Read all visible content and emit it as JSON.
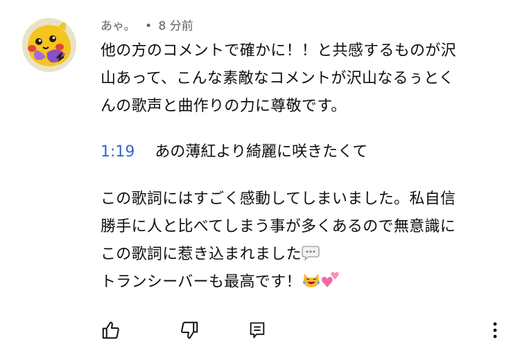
{
  "comment": {
    "author": "あゃ。",
    "separator": "•",
    "time": "8 分前",
    "avatar_icon": "pikachu-avatar",
    "paragraph1": [
      "他の方のコメントで確かに！！と共感するものが沢",
      "山あって、こんな素敵なコメントが沢山なるぅとく",
      "んの歌声と曲作りの力に尊敬です。"
    ],
    "timestamp_link": "1:19",
    "timestamp_text": "あの薄紅より綺麗に咲きたくて",
    "paragraph2": [
      "この歌詞にはすごく感動してしまいました。私自信",
      "勝手に人と比べてしまう事が多くあるので無意識に",
      "この歌詞に惹き込まれました",
      "トランシーバーも最高です！"
    ],
    "emojis": [
      "speech-bubble-icon",
      "laughing-cat-icon",
      "two-hearts-icon"
    ]
  },
  "actions": {
    "like_icon": "thumbs-up-icon",
    "dislike_icon": "thumbs-down-icon",
    "reply_icon": "reply-icon",
    "more_icon": "more-vert-icon"
  },
  "colors": {
    "text": "#0f0f0f",
    "meta": "#606060",
    "link": "#3366cc",
    "background": "#ffffff"
  }
}
